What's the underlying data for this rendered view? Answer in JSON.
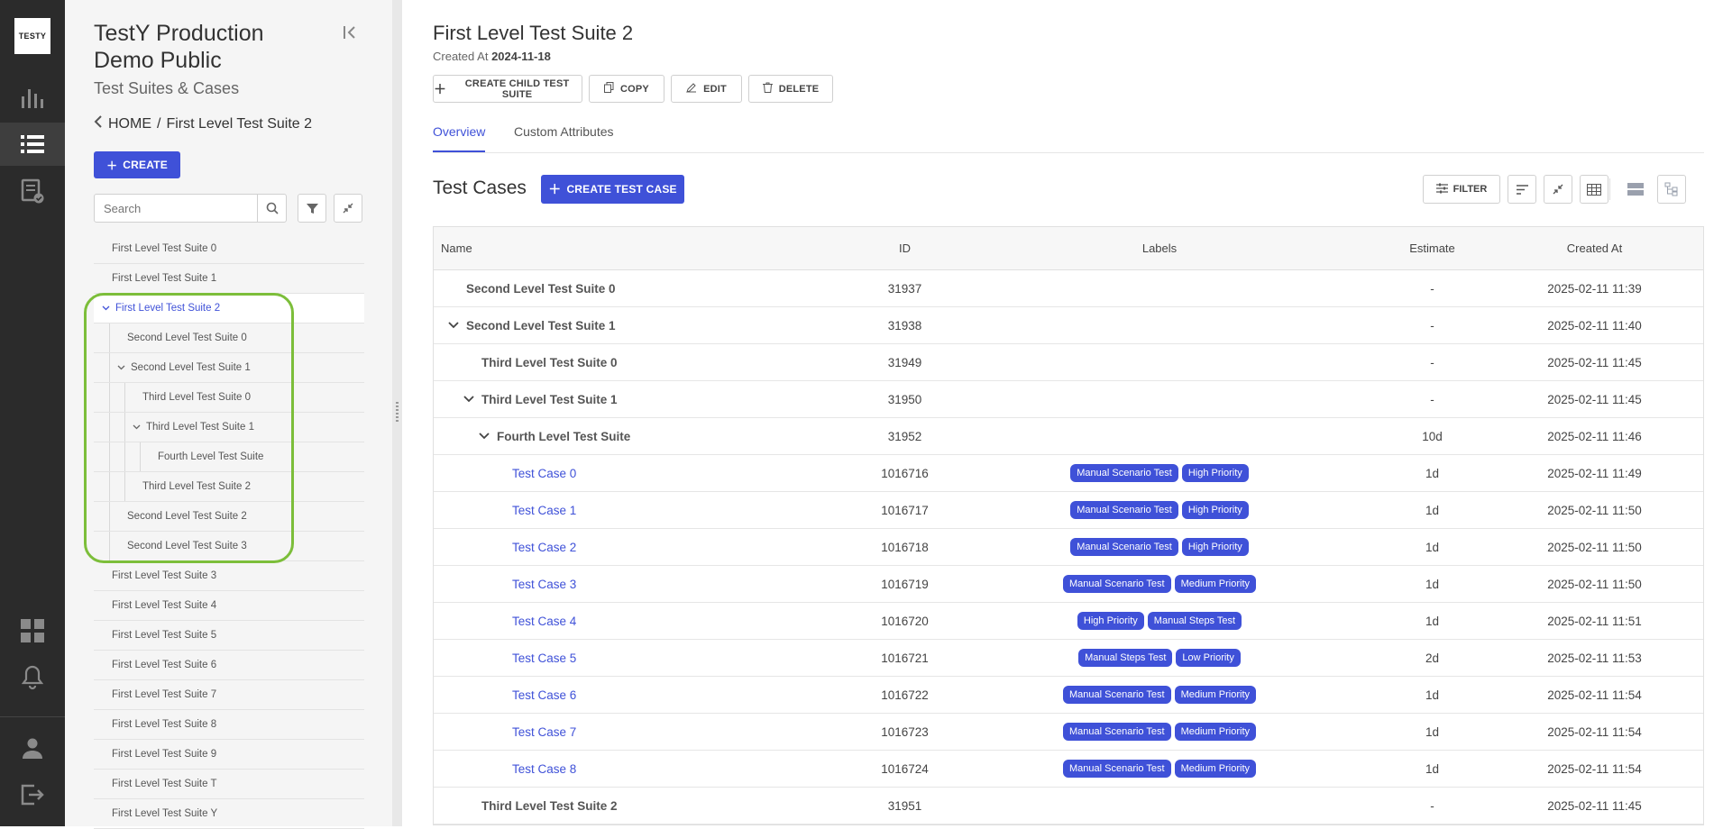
{
  "app": {
    "logo_text": "TESTY"
  },
  "rail": {
    "icons": [
      "statistics-icon",
      "test-suites-list-icon",
      "test-plans-icon",
      "dashboard-icon",
      "notifications-icon",
      "profile-icon",
      "logout-icon"
    ],
    "active": "test-suites-list-icon"
  },
  "sidebar": {
    "project_title": "TestY Production Demo Public",
    "section_title": "Test Suites & Cases",
    "breadcrumb": {
      "home": "HOME",
      "separator": "/",
      "current": "First Level Test Suite 2"
    },
    "create_label": "CREATE",
    "search_placeholder": "Search",
    "tree": [
      {
        "label": "First Level Test Suite 0",
        "depth": 0,
        "expanded": false
      },
      {
        "label": "First Level Test Suite 1",
        "depth": 0,
        "expanded": false
      },
      {
        "label": "First Level Test Suite 2",
        "depth": 0,
        "expanded": true,
        "selected": true
      },
      {
        "label": "Second Level Test Suite 0",
        "depth": 1,
        "expanded": false
      },
      {
        "label": "Second Level Test Suite 1",
        "depth": 1,
        "expanded": true
      },
      {
        "label": "Third Level Test Suite 0",
        "depth": 2,
        "expanded": false
      },
      {
        "label": "Third Level Test Suite 1",
        "depth": 2,
        "expanded": true
      },
      {
        "label": "Fourth Level Test Suite",
        "depth": 3,
        "expanded": false
      },
      {
        "label": "Third Level Test Suite 2",
        "depth": 2,
        "expanded": false
      },
      {
        "label": "Second Level Test Suite 2",
        "depth": 1,
        "expanded": false
      },
      {
        "label": "Second Level Test Suite 3",
        "depth": 1,
        "expanded": false
      },
      {
        "label": "First Level Test Suite 3",
        "depth": 0,
        "expanded": false
      },
      {
        "label": "First Level Test Suite 4",
        "depth": 0,
        "expanded": false
      },
      {
        "label": "First Level Test Suite 5",
        "depth": 0,
        "expanded": false
      },
      {
        "label": "First Level Test Suite 6",
        "depth": 0,
        "expanded": false
      },
      {
        "label": "First Level Test Suite 7",
        "depth": 0,
        "expanded": false
      },
      {
        "label": "First Level Test Suite 8",
        "depth": 0,
        "expanded": false
      },
      {
        "label": "First Level Test Suite 9",
        "depth": 0,
        "expanded": false
      },
      {
        "label": "First Level Test Suite T",
        "depth": 0,
        "expanded": false
      },
      {
        "label": "First Level Test Suite Y",
        "depth": 0,
        "expanded": false
      }
    ]
  },
  "main": {
    "title": "First Level Test Suite 2",
    "created_label": "Created At",
    "created_value": "2024-11-18",
    "actions": {
      "create_child": "CREATE CHILD TEST SUITE",
      "copy": "COPY",
      "edit": "EDIT",
      "delete": "DELETE"
    },
    "tabs": [
      {
        "label": "Overview",
        "active": true
      },
      {
        "label": "Custom Attributes",
        "active": false
      }
    ],
    "test_cases_title": "Test Cases",
    "create_test_case": "CREATE TEST CASE",
    "filter_label": "FILTER",
    "table": {
      "columns": [
        "Name",
        "ID",
        "Labels",
        "Estimate",
        "Created At"
      ],
      "rows": [
        {
          "name": "Second Level Test Suite 0",
          "id": "31937",
          "labels": [],
          "estimate": "-",
          "created": "2025-02-11 11:39",
          "kind": "suite",
          "depth": 0,
          "expanded": false
        },
        {
          "name": "Second Level Test Suite 1",
          "id": "31938",
          "labels": [],
          "estimate": "-",
          "created": "2025-02-11 11:40",
          "kind": "suite",
          "depth": 0,
          "expanded": true
        },
        {
          "name": "Third Level Test Suite 0",
          "id": "31949",
          "labels": [],
          "estimate": "-",
          "created": "2025-02-11 11:45",
          "kind": "suite",
          "depth": 1,
          "expanded": false
        },
        {
          "name": "Third Level Test Suite 1",
          "id": "31950",
          "labels": [],
          "estimate": "-",
          "created": "2025-02-11 11:45",
          "kind": "suite",
          "depth": 1,
          "expanded": true
        },
        {
          "name": "Fourth Level Test Suite",
          "id": "31952",
          "labels": [],
          "estimate": "10d",
          "created": "2025-02-11 11:46",
          "kind": "suite",
          "depth": 2,
          "expanded": true
        },
        {
          "name": "Test Case 0",
          "id": "1016716",
          "labels": [
            "Manual Scenario Test",
            "High Priority"
          ],
          "estimate": "1d",
          "created": "2025-02-11 11:49",
          "kind": "case",
          "depth": 3
        },
        {
          "name": "Test Case 1",
          "id": "1016717",
          "labels": [
            "Manual Scenario Test",
            "High Priority"
          ],
          "estimate": "1d",
          "created": "2025-02-11 11:50",
          "kind": "case",
          "depth": 3
        },
        {
          "name": "Test Case 2",
          "id": "1016718",
          "labels": [
            "Manual Scenario Test",
            "High Priority"
          ],
          "estimate": "1d",
          "created": "2025-02-11 11:50",
          "kind": "case",
          "depth": 3
        },
        {
          "name": "Test Case 3",
          "id": "1016719",
          "labels": [
            "Manual Scenario Test",
            "Medium Priority"
          ],
          "estimate": "1d",
          "created": "2025-02-11 11:50",
          "kind": "case",
          "depth": 3
        },
        {
          "name": "Test Case 4",
          "id": "1016720",
          "labels": [
            "High Priority",
            "Manual Steps Test"
          ],
          "estimate": "1d",
          "created": "2025-02-11 11:51",
          "kind": "case",
          "depth": 3
        },
        {
          "name": "Test Case 5",
          "id": "1016721",
          "labels": [
            "Manual Steps Test",
            "Low Priority"
          ],
          "estimate": "2d",
          "created": "2025-02-11 11:53",
          "kind": "case",
          "depth": 3
        },
        {
          "name": "Test Case 6",
          "id": "1016722",
          "labels": [
            "Manual Scenario Test",
            "Medium Priority"
          ],
          "estimate": "1d",
          "created": "2025-02-11 11:54",
          "kind": "case",
          "depth": 3
        },
        {
          "name": "Test Case 7",
          "id": "1016723",
          "labels": [
            "Manual Scenario Test",
            "Medium Priority"
          ],
          "estimate": "1d",
          "created": "2025-02-11 11:54",
          "kind": "case",
          "depth": 3
        },
        {
          "name": "Test Case 8",
          "id": "1016724",
          "labels": [
            "Manual Scenario Test",
            "Medium Priority"
          ],
          "estimate": "1d",
          "created": "2025-02-11 11:54",
          "kind": "case",
          "depth": 3
        },
        {
          "name": "Third Level Test Suite 2",
          "id": "31951",
          "labels": [],
          "estimate": "-",
          "created": "2025-02-11 11:45",
          "kind": "suite",
          "depth": 1,
          "expanded": false
        }
      ]
    }
  },
  "colors": {
    "accent": "#3f51d8",
    "rail_bg": "#2b2b2b",
    "sidebar_bg": "#f5f5f5",
    "highlight": "#7cbe3a"
  }
}
